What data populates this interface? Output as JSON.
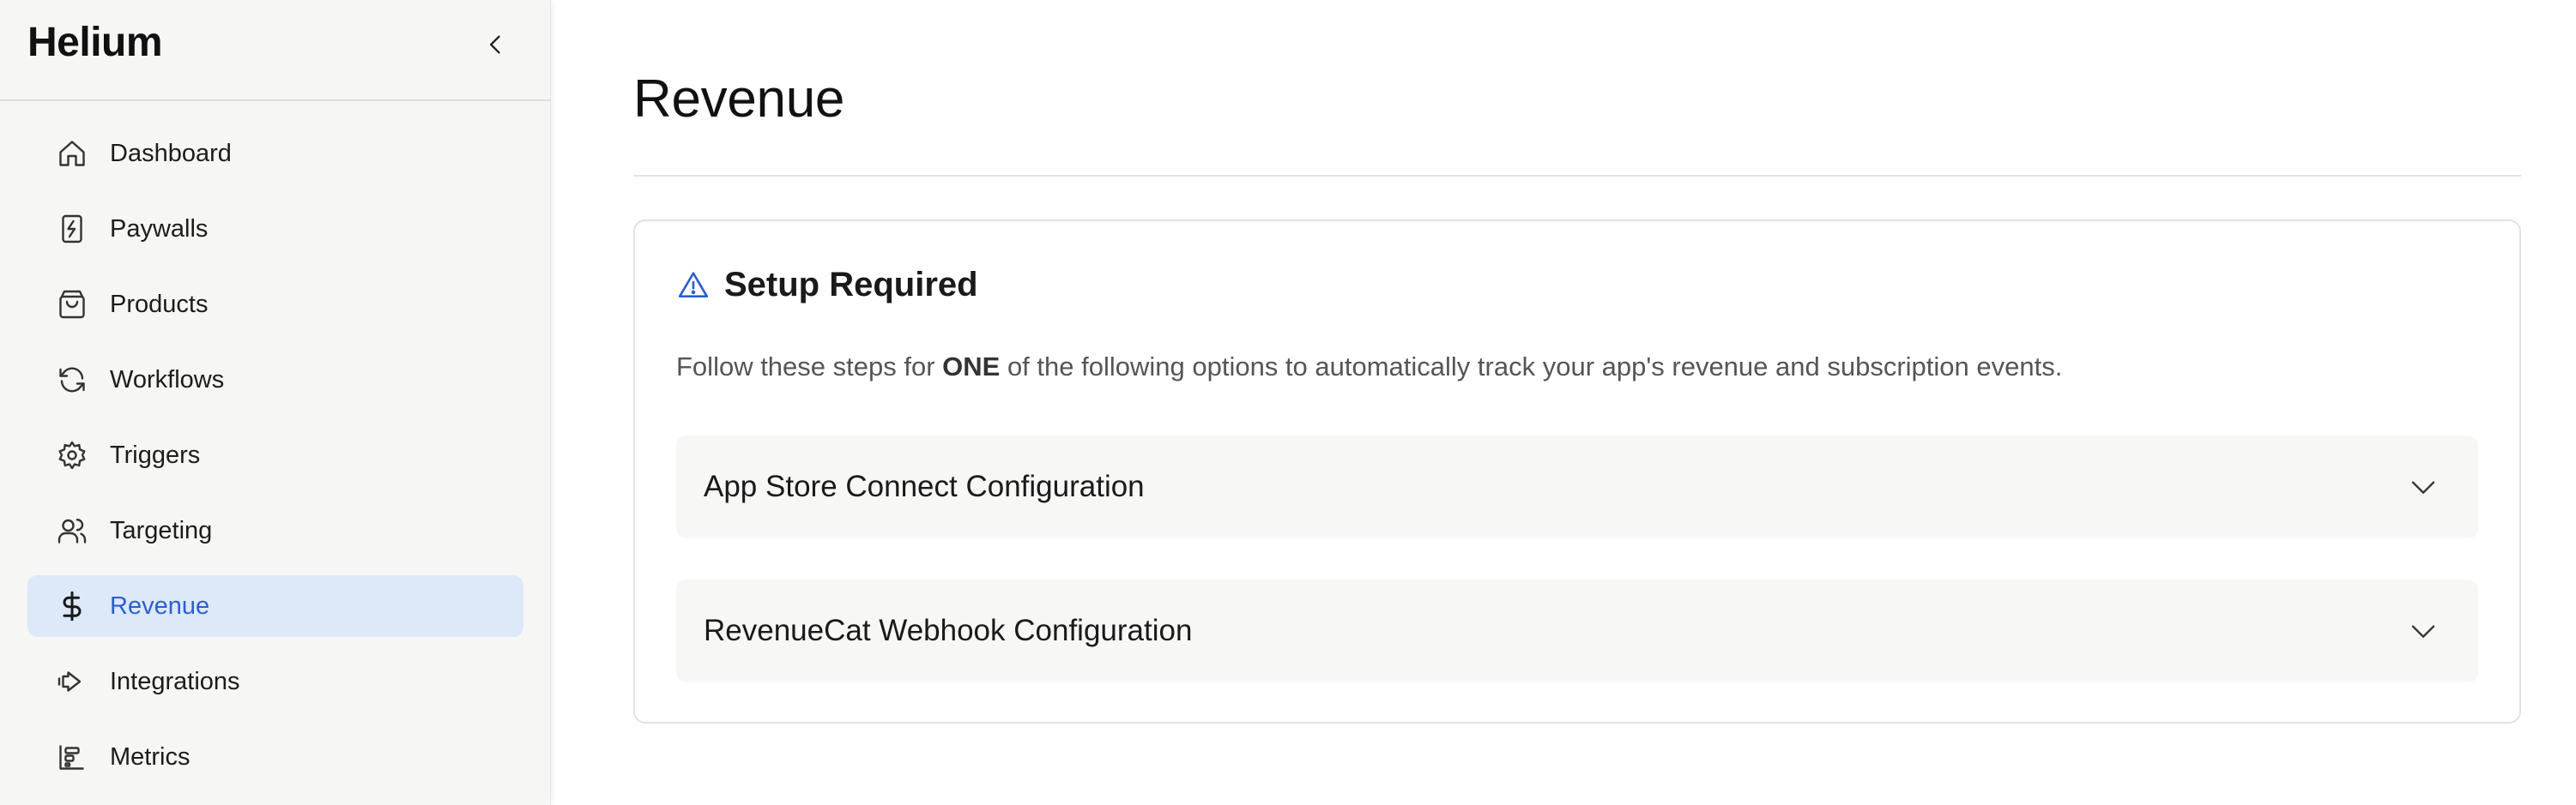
{
  "sidebar": {
    "brand": "Helium",
    "items": [
      {
        "label": "Dashboard",
        "icon": "home-icon",
        "active": false
      },
      {
        "label": "Paywalls",
        "icon": "paywall-icon",
        "active": false
      },
      {
        "label": "Products",
        "icon": "shopping-bag-icon",
        "active": false
      },
      {
        "label": "Workflows",
        "icon": "refresh-icon",
        "active": false
      },
      {
        "label": "Triggers",
        "icon": "gear-icon",
        "active": false
      },
      {
        "label": "Targeting",
        "icon": "users-icon",
        "active": false
      },
      {
        "label": "Revenue",
        "icon": "dollar-icon",
        "active": true
      },
      {
        "label": "Integrations",
        "icon": "arrow-right-icon",
        "active": false
      },
      {
        "label": "Metrics",
        "icon": "chart-icon",
        "active": false
      }
    ]
  },
  "main": {
    "title": "Revenue",
    "card": {
      "title": "Setup Required",
      "desc_before": "Follow these steps for ",
      "desc_bold": "ONE",
      "desc_after": " of the following options to automatically track your app's revenue and subscription events.",
      "accordions": [
        {
          "label": "App Store Connect Configuration"
        },
        {
          "label": "RevenueCat Webhook Configuration"
        }
      ]
    }
  },
  "colors": {
    "accent": "#2b5fd0",
    "active_bg": "#dde8f8",
    "sidebar_bg": "#f6f6f4",
    "accordion_bg": "#f7f7f6",
    "warning_icon": "#2b5fd0"
  }
}
